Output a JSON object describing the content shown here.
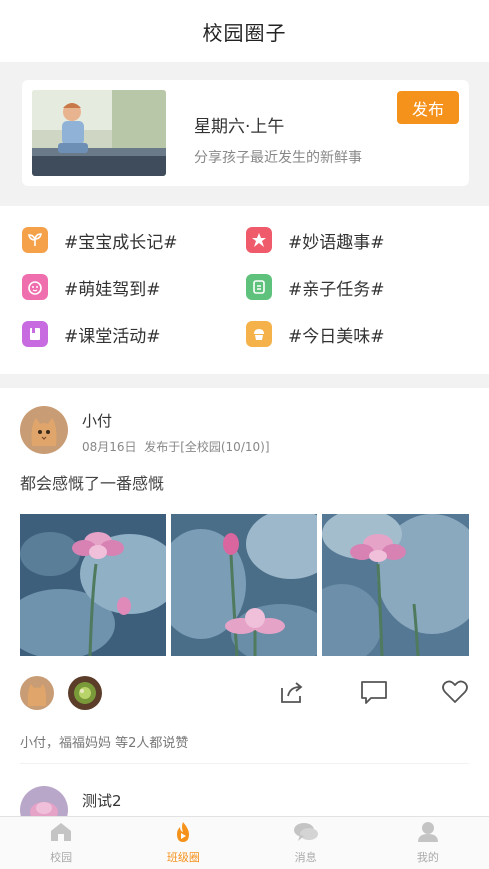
{
  "header": {
    "title": "校园圈子"
  },
  "composer": {
    "day": "星期六·上午",
    "prompt": "分享孩子最近发生的新鲜事",
    "publish_label": "发布"
  },
  "topics": [
    {
      "label": "#宝宝成长记#",
      "icon": "sprout-icon",
      "color": "#f5a14a"
    },
    {
      "label": "#妙语趣事#",
      "icon": "star-burst-icon",
      "color": "#ef5b6b"
    },
    {
      "label": "#萌娃驾到#",
      "icon": "baby-face-icon",
      "color": "#ef6fae"
    },
    {
      "label": "#亲子任务#",
      "icon": "checklist-icon",
      "color": "#5fc27c"
    },
    {
      "label": "#课堂活动#",
      "icon": "book-icon",
      "color": "#c86be0"
    },
    {
      "label": "#今日美味#",
      "icon": "cupcake-icon",
      "color": "#f5b24a"
    }
  ],
  "post": {
    "author": "小付",
    "date": "08月16日",
    "published_to": "发布于[全校园(10/10)]",
    "text": "都会感慨了一番感慨",
    "likes_text": "小付，福福妈妈  等2人都说赞"
  },
  "next_post": {
    "author": "测试2"
  },
  "tabbar": {
    "items": [
      {
        "label": "校园",
        "icon": "school-icon"
      },
      {
        "label": "班级圈",
        "icon": "flame-icon"
      },
      {
        "label": "消息",
        "icon": "chat-icon"
      },
      {
        "label": "我的",
        "icon": "user-icon"
      }
    ],
    "active": "班级圈"
  },
  "colors": {
    "accent": "#f5921b",
    "background": "#f2f2f2"
  }
}
